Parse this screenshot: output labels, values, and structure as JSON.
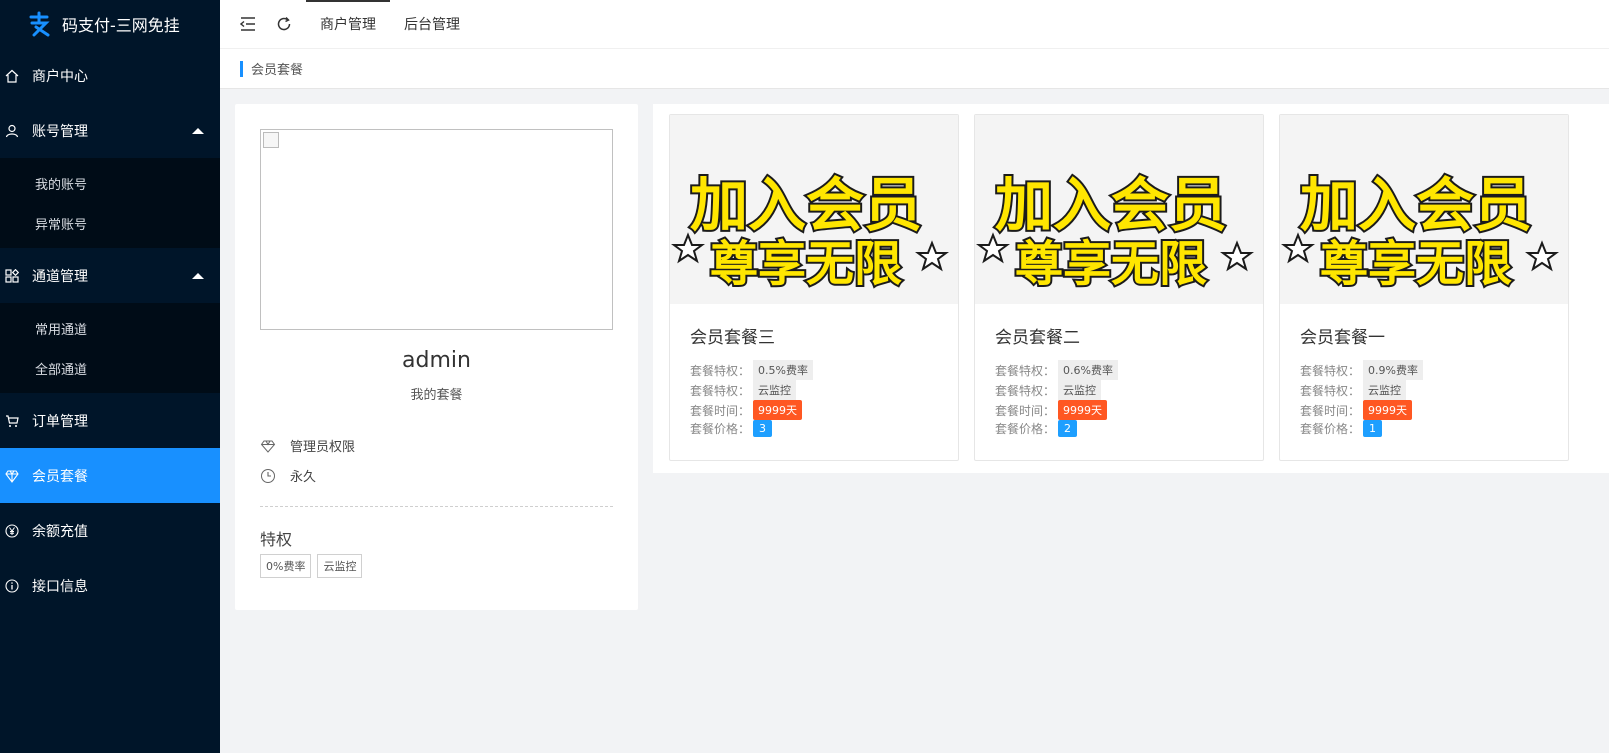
{
  "app": {
    "title": "码支付-三网免挂"
  },
  "sidebar": {
    "items": [
      {
        "label": "商户中心",
        "icon": "home-icon"
      },
      {
        "label": "账号管理",
        "icon": "user-icon",
        "children": [
          "我的账号",
          "异常账号"
        ]
      },
      {
        "label": "通道管理",
        "icon": "apps-icon",
        "children": [
          "常用通道",
          "全部通道"
        ]
      },
      {
        "label": "订单管理",
        "icon": "cart-icon"
      },
      {
        "label": "会员套餐",
        "icon": "diamond-icon",
        "active": true
      },
      {
        "label": "余额充值",
        "icon": "yen-icon"
      },
      {
        "label": "接口信息",
        "icon": "info-icon"
      }
    ],
    "accent": "#1890ff",
    "background": "#001529"
  },
  "topbar": {
    "tabs": [
      "商户管理",
      "后台管理"
    ]
  },
  "breadcrumb": {
    "current": "会员套餐"
  },
  "profile": {
    "name": "admin",
    "subtitle": "我的套餐",
    "role": "管理员权限",
    "duration": "永久",
    "privilege_title": "特权",
    "privileges": [
      "0%费率",
      "云监控"
    ]
  },
  "packages": {
    "image_text_line1": "加入会员",
    "image_text_line2": "尊享无限",
    "labels": {
      "privilege": "套餐特权：",
      "time": "套餐时间：",
      "price": "套餐价格："
    },
    "items": [
      {
        "name": "会员套餐三",
        "rate": "0.5%费率",
        "feature": "云监控",
        "time": "9999天",
        "price": "3"
      },
      {
        "name": "会员套餐二",
        "rate": "0.6%费率",
        "feature": "云监控",
        "time": "9999天",
        "price": "2"
      },
      {
        "name": "会员套餐一",
        "rate": "0.9%费率",
        "feature": "云监控",
        "time": "9999天",
        "price": "1"
      }
    ]
  }
}
